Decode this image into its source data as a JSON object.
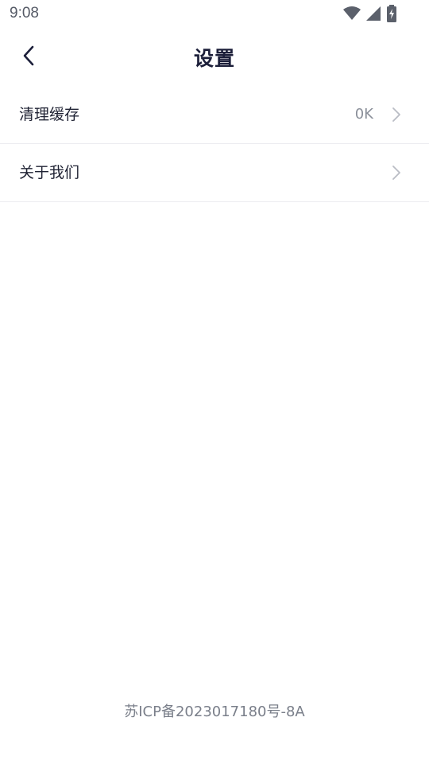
{
  "status_bar": {
    "time": "9:08",
    "icons": [
      "wifi-icon",
      "signal-icon",
      "battery-charging-icon"
    ]
  },
  "header": {
    "back_icon": "chevron-left-icon",
    "title": "设置"
  },
  "settings": {
    "items": [
      {
        "label": "清理缓存",
        "value": "0K",
        "icon": "chevron-right-icon"
      },
      {
        "label": "关于我们",
        "value": "",
        "icon": "chevron-right-icon"
      }
    ]
  },
  "footer": {
    "icp": "苏ICP备2023017180号-8A"
  },
  "colors": {
    "title": "#1c1f3a",
    "text": "#1f2233",
    "muted": "#8a8f99",
    "divider": "#ececf0",
    "background": "#ffffff"
  }
}
